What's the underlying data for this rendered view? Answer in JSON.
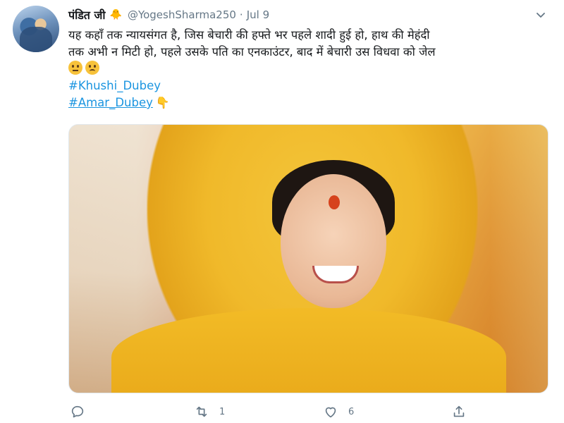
{
  "tweet": {
    "display_name": "पंडित जी",
    "badge_icon": "chick-emoji-icon",
    "handle": "@YogeshSharma250",
    "separator": "·",
    "date": "Jul 9",
    "text_line1": "यह कहाँ तक न्यायसंगत है, जिस बेचारी की हफ्ते भर पहले शादी हुई हो, हाथ की मेहंदी",
    "text_line2": "तक अभी न मिटी हो, पहले उसके पति का एनकाउंटर, बाद में बेचारी उस विधवा को जेल",
    "emojis": [
      "neutral-face-emoji",
      "sad-face-emoji"
    ],
    "hashtags": [
      "#Khushi_Dubey",
      "#Amar_Dubey"
    ],
    "pointing_emoji": "pointing-down-emoji"
  },
  "media": {
    "description_icon": "photo-woman-yellow-dupatta"
  },
  "actions": {
    "reply_icon": "reply-icon",
    "retweet_icon": "retweet-icon",
    "retweet_count": "1",
    "like_icon": "heart-icon",
    "like_count": "6",
    "share_icon": "share-icon"
  },
  "colors": {
    "link": "#1b95e0",
    "muted": "#657786",
    "text": "#14171a"
  }
}
